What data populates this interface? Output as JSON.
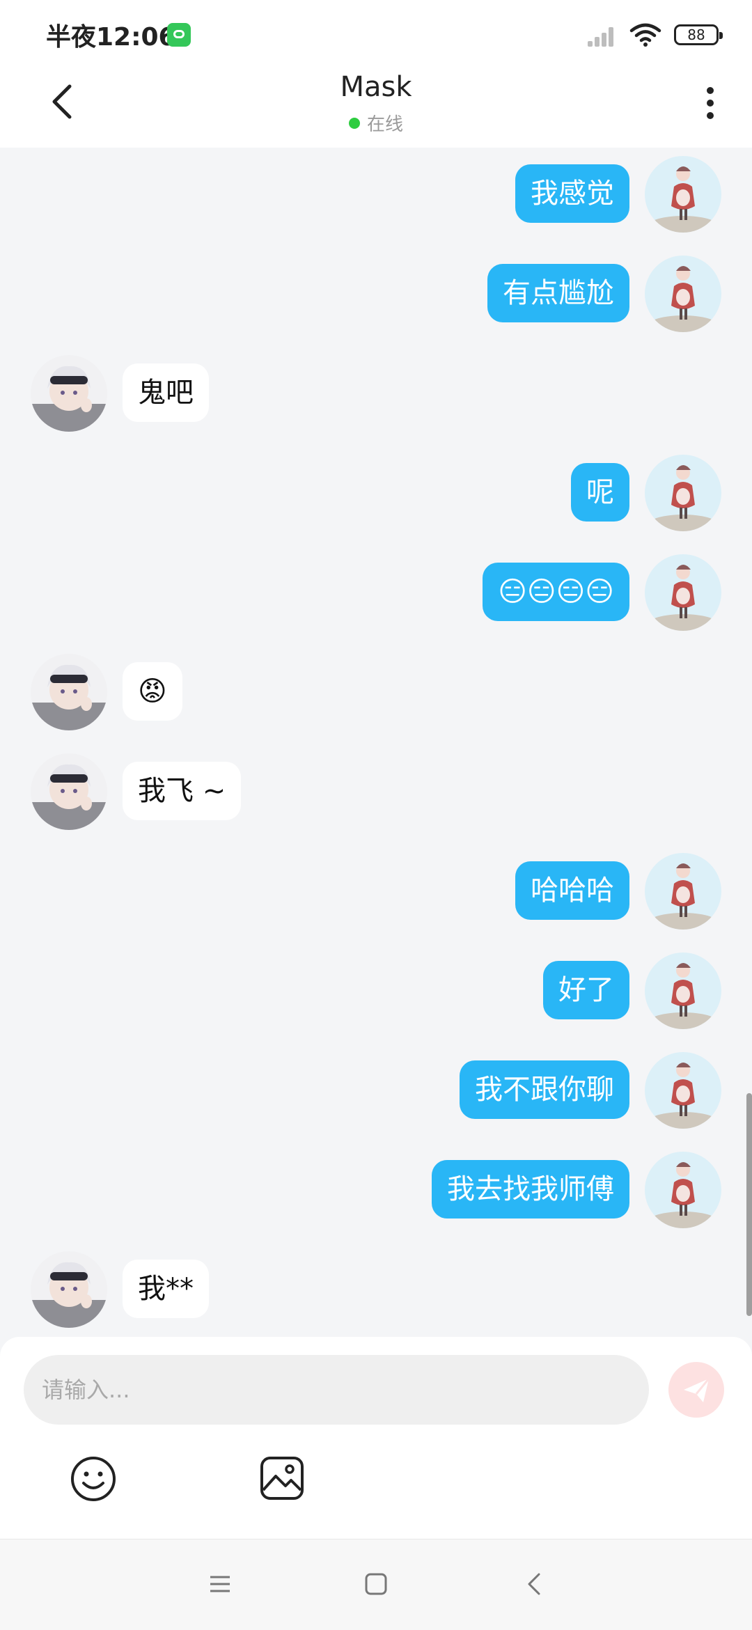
{
  "status_bar": {
    "time": "半夜12:06",
    "battery": "88"
  },
  "header": {
    "title": "Mask",
    "status": "在线"
  },
  "messages": [
    {
      "side": "right",
      "text": "我感觉"
    },
    {
      "side": "right",
      "text": "有点尴尬"
    },
    {
      "side": "left",
      "text": "鬼吧"
    },
    {
      "side": "right",
      "text": "呢"
    },
    {
      "side": "right",
      "text": "😑😑😑😑"
    },
    {
      "side": "left",
      "text": "😡"
    },
    {
      "side": "left",
      "text": "我飞 ~"
    },
    {
      "side": "right",
      "text": "哈哈哈"
    },
    {
      "side": "right",
      "text": "好了"
    },
    {
      "side": "right",
      "text": "我不跟你聊"
    },
    {
      "side": "right",
      "text": "我去找我师傅"
    },
    {
      "side": "left",
      "text": "我**"
    }
  ],
  "input": {
    "placeholder": "请输入..."
  },
  "icons": {
    "back": "back-arrow-icon",
    "more": "more-vertical-icon",
    "send": "send-icon",
    "emoji": "emoji-icon",
    "image": "image-icon",
    "nav_menu": "menu-icon",
    "nav_home": "home-square-icon",
    "nav_back": "nav-back-icon"
  },
  "colors": {
    "bubble_self": "#29b6f6",
    "bubble_other": "#ffffff",
    "online": "#2ecc40",
    "send_button": "#fde1e1"
  }
}
